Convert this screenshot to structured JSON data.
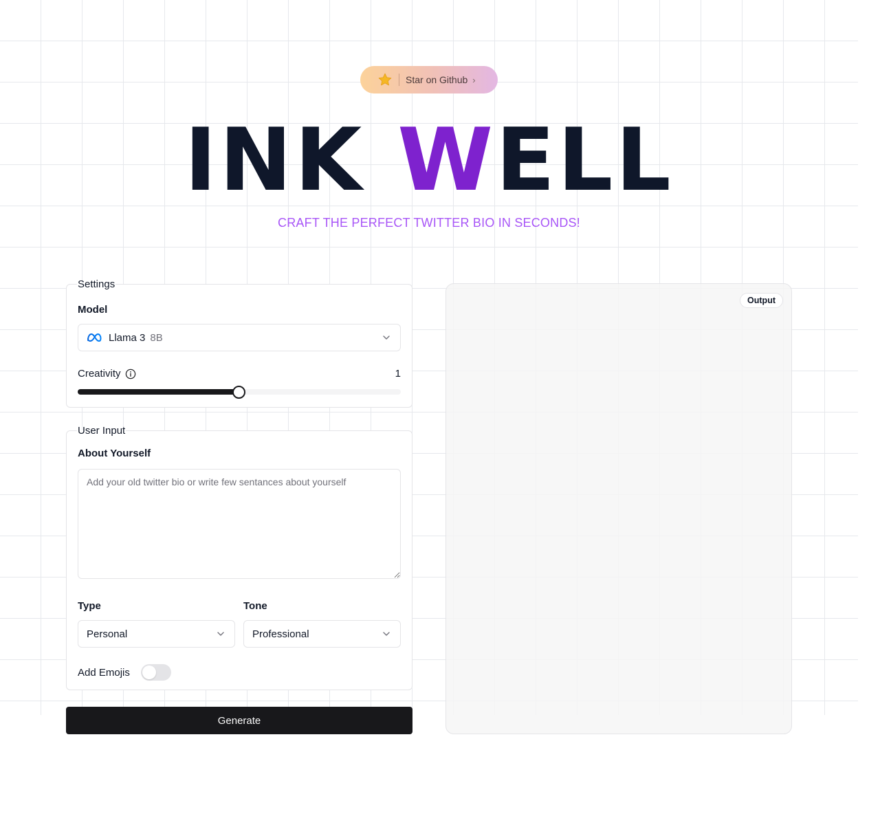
{
  "github": {
    "label": "Star on Github",
    "chevron": "›",
    "icon": "star-icon"
  },
  "hero": {
    "title_prefix": "INK ",
    "title_accent": "W",
    "title_suffix": "ELL",
    "accent_color": "#7e22ce"
  },
  "tagline": "CRAFT THE PERFECT TWITTER BIO IN SECONDS!",
  "settings": {
    "legend": "Settings",
    "model_label": "Model",
    "model_name": "Llama 3",
    "model_size": "8B",
    "creativity_label": "Creativity",
    "creativity_value": "1",
    "creativity_fraction": 0.5
  },
  "user_input": {
    "legend": "User Input",
    "about_label": "About Yourself",
    "about_placeholder": "Add your old twitter bio or write few sentances about yourself",
    "type_label": "Type",
    "type_value": "Personal",
    "tone_label": "Tone",
    "tone_value": "Professional",
    "emoji_label": "Add Emojis",
    "emoji_enabled": false
  },
  "generate_label": "Generate",
  "output_label": "Output"
}
